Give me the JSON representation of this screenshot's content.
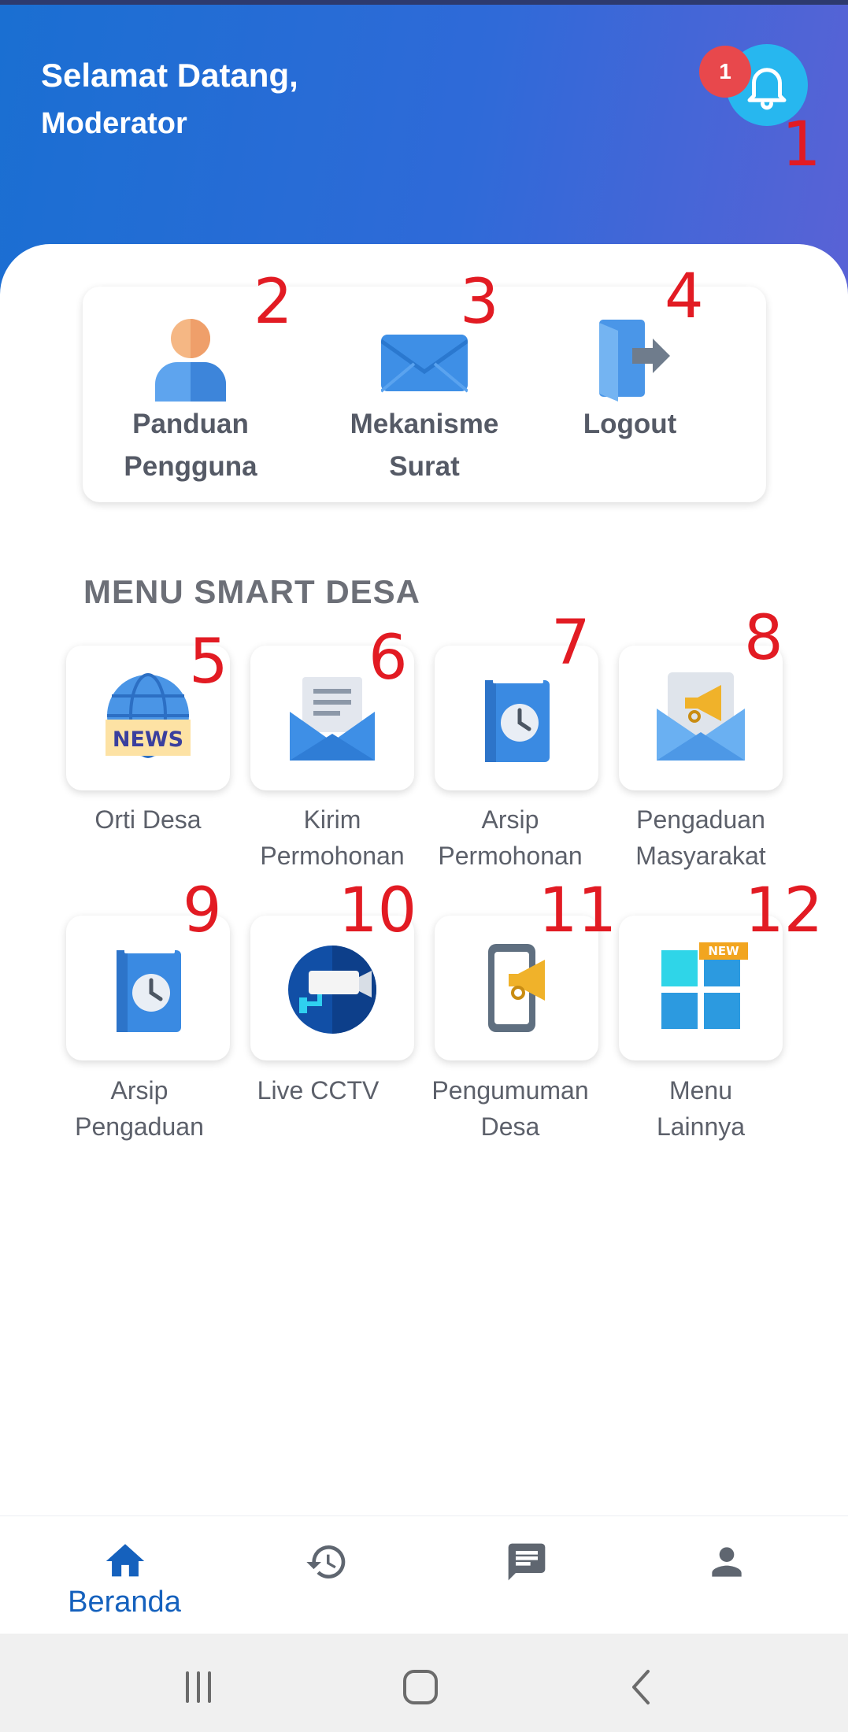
{
  "header": {
    "greeting_line1": "Selamat Datang,",
    "greeting_line2": "Moderator",
    "notification_count": "1"
  },
  "annotations": [
    "1",
    "2",
    "3",
    "4",
    "5",
    "6",
    "7",
    "8",
    "9",
    "10",
    "11",
    "12"
  ],
  "quick_actions": [
    {
      "label": "Panduan\nPengguna",
      "icon": "user-guide-icon"
    },
    {
      "label": "Mekanisme\nSurat",
      "icon": "mail-envelope-icon"
    },
    {
      "label": "Logout",
      "icon": "logout-door-icon"
    }
  ],
  "section_title": "MENU SMART DESA",
  "menu_items": [
    {
      "label": "Orti Desa",
      "icon": "news-globe-icon"
    },
    {
      "label": "Kirim\nPermohonan",
      "icon": "open-envelope-letter-icon"
    },
    {
      "label": "Arsip\nPermohonan",
      "icon": "archive-clock-icon"
    },
    {
      "label": "Pengaduan\nMasyarakat",
      "icon": "megaphone-envelope-icon"
    },
    {
      "label": "Arsip\nPengaduan",
      "icon": "archive-clock-icon"
    },
    {
      "label": "Live CCTV",
      "icon": "cctv-camera-icon"
    },
    {
      "label": "Pengumuman\nDesa",
      "icon": "phone-megaphone-icon"
    },
    {
      "label": "Menu\nLainnya",
      "icon": "grid-new-icon",
      "badge": "NEW"
    }
  ],
  "bottom_nav": [
    {
      "label": "Beranda",
      "icon": "home-icon",
      "active": true
    },
    {
      "label": "",
      "icon": "history-icon",
      "active": false
    },
    {
      "label": "",
      "icon": "chat-icon",
      "active": false
    },
    {
      "label": "",
      "icon": "profile-icon",
      "active": false
    }
  ],
  "colors": {
    "header_start": "#1a6fd2",
    "header_end": "#5a62d6",
    "accent": "#1561bd",
    "annotation": "#e21b23",
    "badge": "#e8484c"
  }
}
